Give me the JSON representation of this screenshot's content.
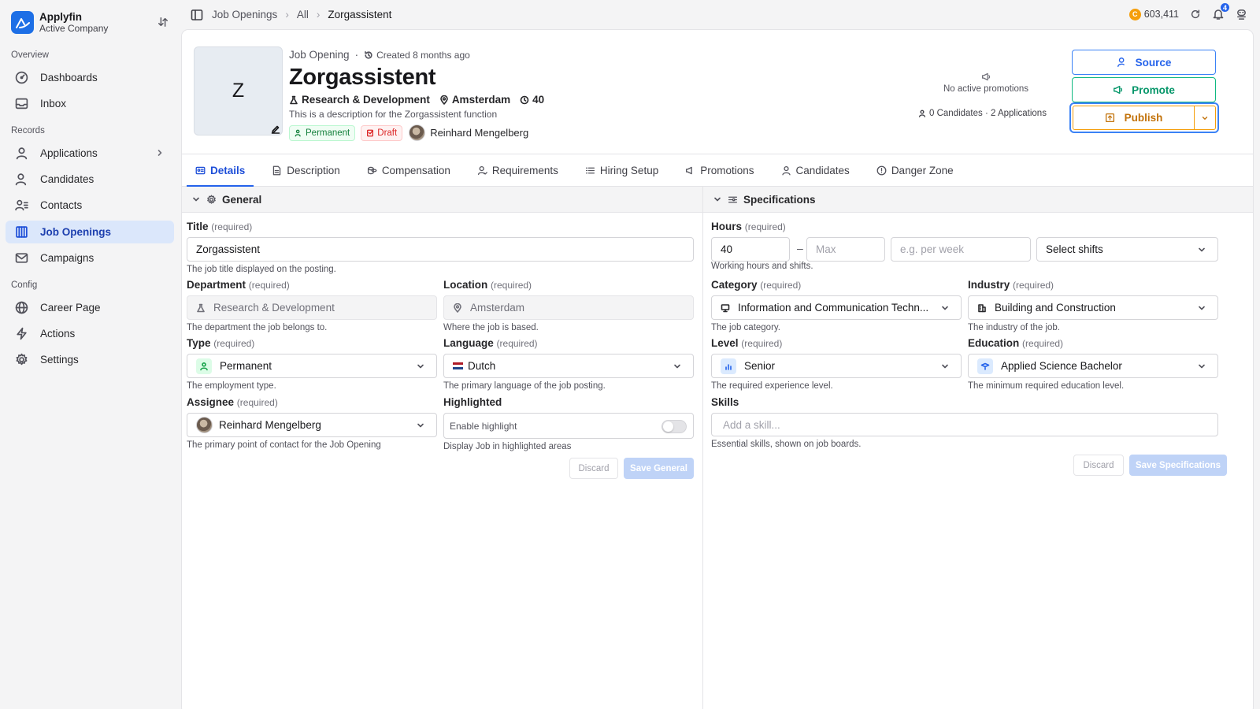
{
  "company": {
    "name": "Applyfin",
    "subtitle": "Active Company"
  },
  "sidebar": {
    "sections": [
      {
        "title": "Overview",
        "items": [
          {
            "label": "Dashboards",
            "icon": "dashboard-icon"
          },
          {
            "label": "Inbox",
            "icon": "inbox-icon"
          }
        ]
      },
      {
        "title": "Records",
        "items": [
          {
            "label": "Applications",
            "icon": "user-icon",
            "has_children": true
          },
          {
            "label": "Candidates",
            "icon": "users-icon"
          },
          {
            "label": "Contacts",
            "icon": "contacts-icon"
          },
          {
            "label": "Job Openings",
            "icon": "building-icon",
            "active": true
          },
          {
            "label": "Campaigns",
            "icon": "mail-icon"
          }
        ]
      },
      {
        "title": "Config",
        "items": [
          {
            "label": "Career Page",
            "icon": "globe-icon"
          },
          {
            "label": "Actions",
            "icon": "bolt-icon"
          },
          {
            "label": "Settings",
            "icon": "gear-icon"
          }
        ]
      }
    ]
  },
  "breadcrumb": [
    "Job Openings",
    "All",
    "Zorgassistent"
  ],
  "topbar": {
    "credits": "603,411",
    "notifications": "4",
    "coin_symbol": "C"
  },
  "job": {
    "initial": "Z",
    "kicker": "Job Opening",
    "created": "Created 8 months ago",
    "title": "Zorgassistent",
    "department": "Research & Development",
    "location": "Amsterdam",
    "hours": "40",
    "description": "This is a description for the Zorgassistent function",
    "type_tag": "Permanent",
    "status_tag": "Draft",
    "assignee": "Reinhard Mengelberg"
  },
  "promotions": {
    "empty_text": "No active promotions"
  },
  "counts": "0 Candidates · 2 Applications",
  "actions": {
    "source": "Source",
    "promote": "Promote",
    "publish": "Publish"
  },
  "tabs": [
    "Details",
    "Description",
    "Compensation",
    "Requirements",
    "Hiring Setup",
    "Promotions",
    "Candidates",
    "Danger Zone"
  ],
  "general": {
    "heading": "General",
    "required_text": "(required)",
    "title": {
      "label": "Title",
      "value": "Zorgassistent",
      "help": "The job title displayed on the posting."
    },
    "department": {
      "label": "Department",
      "value": "Research & Development",
      "help": "The department the job belongs to."
    },
    "location": {
      "label": "Location",
      "value": "Amsterdam",
      "help": "Where the job is based."
    },
    "type": {
      "label": "Type",
      "value": "Permanent",
      "help": "The employment type."
    },
    "language": {
      "label": "Language",
      "value": "Dutch",
      "help": "The primary language of the job posting."
    },
    "assignee": {
      "label": "Assignee",
      "value": "Reinhard Mengelberg",
      "help": "The primary point of contact for the Job Opening"
    },
    "highlighted": {
      "label": "Highlighted",
      "toggle_text": "Enable highlight",
      "help": "Display Job in highlighted areas",
      "enabled": false
    },
    "discard": "Discard",
    "save": "Save General"
  },
  "specs": {
    "heading": "Specifications",
    "required_text": "(required)",
    "hours": {
      "label": "Hours",
      "min": "40",
      "max_placeholder": "Max",
      "per_placeholder": "e.g. per week",
      "shifts_placeholder": "Select shifts",
      "help": "Working hours and shifts.",
      "dash": "–"
    },
    "category": {
      "label": "Category",
      "value": "Information and Communication Techn...",
      "help": "The job category."
    },
    "industry": {
      "label": "Industry",
      "value": "Building and Construction",
      "help": "The industry of the job."
    },
    "level": {
      "label": "Level",
      "value": "Senior",
      "help": "The required experience level."
    },
    "education": {
      "label": "Education",
      "value": "Applied Science Bachelor",
      "help": "The minimum required education level."
    },
    "skills": {
      "label": "Skills",
      "placeholder": "Add a skill...",
      "help": "Essential skills, shown on job boards."
    },
    "discard": "Discard",
    "save": "Save Specifications"
  }
}
